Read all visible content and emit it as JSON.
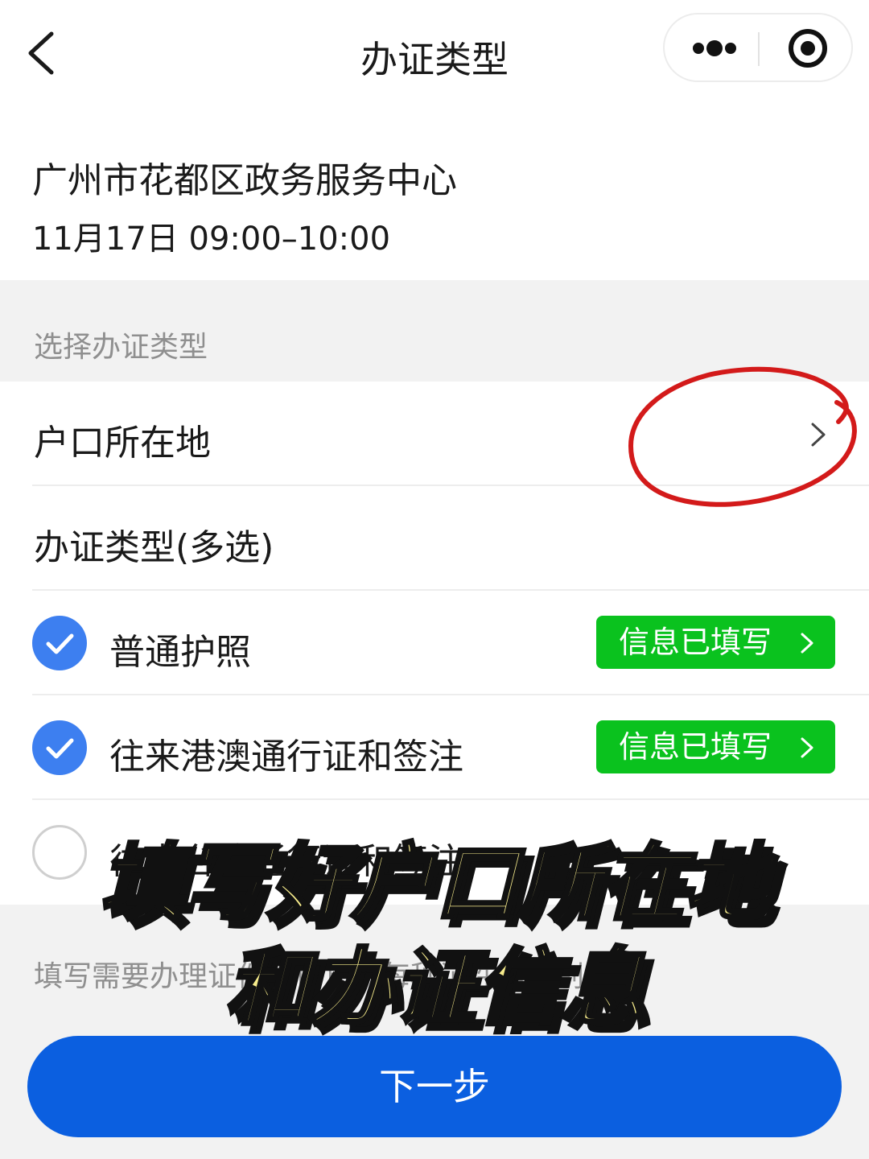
{
  "navbar": {
    "title": "办证类型",
    "back_icon": "chevron-left-icon",
    "more_icon": "more-dots-icon",
    "close_icon": "target-circle-icon"
  },
  "appointment": {
    "venue": "广州市花都区政务服务中心",
    "slot": "11月17日  09:00–10:00"
  },
  "section": {
    "label": "选择办证类型"
  },
  "hukou_row": {
    "label": "户口所在地",
    "chevron_icon": "chevron-right-icon"
  },
  "types_header": {
    "label": "办证类型(多选)"
  },
  "options": [
    {
      "label": "普通护照",
      "checked": true,
      "badge": "信息已填写"
    },
    {
      "label": "往来港澳通行证和签注",
      "checked": true,
      "badge": "信息已填写"
    },
    {
      "label": "往来台湾通行证和签注",
      "checked": false,
      "badge": ""
    }
  ],
  "hint": "填写需要办理证件的信息，每种证件需分别填写",
  "next_button": "下一步",
  "overlay_caption": {
    "line1": "填写好户口所在地",
    "line2": "和办证信息"
  },
  "colors": {
    "accent_blue": "#0b5fe0",
    "check_blue": "#3d7ff0",
    "badge_green": "#0ac21e",
    "annotation_red": "#d31a1a",
    "caption_yellow": "#f7ec8c"
  }
}
